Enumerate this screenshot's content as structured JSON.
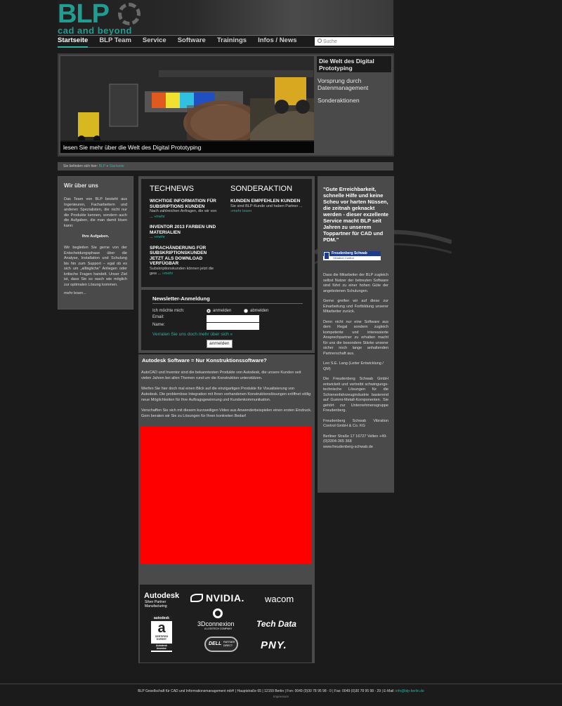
{
  "logo": {
    "text": "BLP",
    "tagline": "cad and beyond"
  },
  "nav": {
    "items": [
      "Startseite",
      "BLP Team",
      "Service",
      "Software",
      "Trainings",
      "Infos / News"
    ]
  },
  "search": {
    "placeholder": "Suche"
  },
  "hero": {
    "caption": "lesen Sie mehr über die Welt des Digital Prototyping",
    "side_items": [
      "Die Welt des Digital Prototyping",
      "Vorsprung durch Datenmanagement",
      "Sonderaktionen"
    ]
  },
  "breadcrumb": {
    "prefix": "Sie befinden sich hier:",
    "home": "BLP",
    "sep": "»",
    "current": "Startseite"
  },
  "left": {
    "title": "Wir über uns",
    "p1": "Das Team von BLP besteht aus Ingenieuren, Facharbeitern und anderen Spezialisten, die nicht nur die Produkte kennen, sondern auch die Aufgaben, die man damit lösen kann:",
    "mid": "Ihre Aufgaben.",
    "p2": "Wir begleiten Sie gerne von der Entscheidungsphase über die Analyse, Installation und Schulung bis hin zum Support – egal ob es sich um „alltägliche\" Anliegen oder kritische Fragen handelt. Unser Ziel ist, dass Sie so rasch wie möglich zur optimalen Lösung kommen.",
    "more": "mehr lesen..."
  },
  "news": {
    "technews_title": "TECHNEWS",
    "sonder_title": "SONDERAKTION",
    "technews": [
      {
        "title": "WICHTIGE INFORMATION FÜR SUBSRIPTIONS KUNDEN",
        "text": "Nach zahlreichen Anfragen, die wir von ...",
        "more": "»mehr"
      },
      {
        "title": "INVENTOR 2013 FARBEN UND MATERIALIEN",
        "text": "...",
        "more": "»mehr"
      },
      {
        "title": "SPRACHÄNDERUNG FÜR SUBSKRIPTIONSKUNDEN JETZT ALS DOWNLOAD VERFÜGBAR",
        "text": "Subskriptionskunden können jetzt die gew ...",
        "more": "»mehr"
      }
    ],
    "sonder": [
      {
        "title": "KUNDEN EMPFEHLEN KUNDEN",
        "text": "Sie sind BLP-Kunde und haben Partner ...",
        "more": "»mehr lesen"
      }
    ]
  },
  "newsletter": {
    "title": "Newsletter-Anmeldung",
    "choice_label": "Ich möchte mich:",
    "opt_in": "anmelden",
    "opt_out": "abmelden",
    "email_label": "Email:",
    "name_label": "Name:",
    "link": "Verraten Sie uns doch mehr über sich »",
    "button": "anmelden"
  },
  "article": {
    "title": "Autodesk Software = Nur Konstruktionssoftware?",
    "p1": "AutoCAD und Inventor sind die bekanntesten Produkte von Autodesk, die unsere Kunden seit vielen Jahren bei allen Themen rund um die Konstruktion unterstützen.",
    "p2": "Werfen Sie hier doch mal einen Blick auf die einzigartigen Produkte für Visualisierung von Autodesk. Die problemlose Integration mit Ihren vorhandenen Konstruktionslösungen eröffnet völlig neue Möglichkeiten für Ihre Auftragsgewinnung und Kundenkommunikation.",
    "p3": "Verschaffen Sie sich mit diesem kurzweiligen Video aus Anwenderbeispielen einen ersten Eindruck. Gern beraten wir Sie zu Lösungen für Ihren konkreten Bedarf"
  },
  "partners": {
    "autodesk": "Autodesk",
    "autodesk_sub1": "Silver Partner",
    "autodesk_sub2": "Manufacturing",
    "nvidia": "NVIDIA.",
    "wacom": "wacom",
    "cert_top": "autodesk",
    "cert_letter": "a",
    "cert_mid": "CERTIFIED EXPERT",
    "cert_bottom": "Autodesk Inventor",
    "connexion": "3Dconnexion",
    "connexion_sub": "A LOGITECH COMPANY",
    "techdata": "Tech Data",
    "dell": "DELL",
    "dell_sub": "PARTNER DIRECT",
    "pny": "PNY."
  },
  "right": {
    "quote": "\"Gute Erreichbarkeit, schnelle Hilfe und keine Scheu vor harten Nüssen, die zeitnah geknackt werden - dieser exzellente Service macht BLP seit Jahren zu unserem Toppartner für CAD und PDM.\"",
    "fs_brand": "Freudenberg Schwab",
    "fs_sub": "Vibration Control",
    "p1": "Dass die Mitarbeiter der BLP zugleich selbst Nutzer der betreuten Software sind führt zu einer hohen Güte der angebotenen Schulungen.",
    "p2": "Gerne greifen wir auf diese zur Einarbeitung und Fortbildung unserer Mitarbeiter zurück.",
    "p3": "Denn nicht nur eine Software aus dem Regal sondern zugleich kompetente und interessierte Ansprechpartner zu erhalten macht für uns die besondere Stärke unserer sicher noch lange anhaltenden Partnerschaft aus.",
    "p4": "Leo S.E. Lang (Leiter Entwicklung / QM)",
    "p5": "Die Freudenberg Schwab GmbH entwickelt und vertreibt schwingungs-technische Lösungen für die Schienenfahrzeugindustrie basierend auf Gummi-Metall-Komponenten. Sie gehört zur Unternehmensgruppe Freudenberg.",
    "p6": "Freudenberg Schwab Vibration Control GmbH & Co. KG",
    "p7": "Berliner Straße 17 16727 Velten +49-(0)3304-365 368",
    "link": "www.freudenberg-schwab.de"
  },
  "footer": {
    "text": "BLP Gesellschaft für CAD und Informationsmanagement mbH | Hauptstraße 65 | 12159 Berlin | Fon: 0049 (0)30 78 95 98 - 0 | Fax: 0049 (0)30 78 95 98 - 29 | E-Mail:",
    "email": "info@blp-berlin.de",
    "sub": "Impressum"
  }
}
